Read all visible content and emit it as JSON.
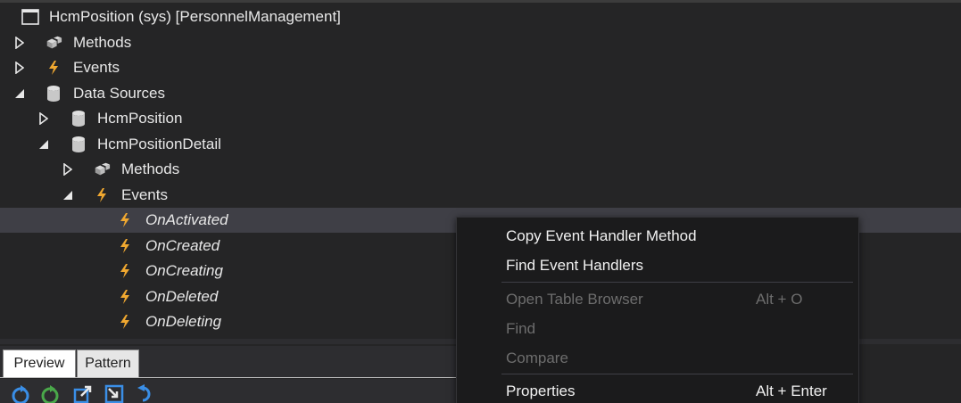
{
  "tree": {
    "root_label": "HcmPosition (sys) [PersonnelManagement]",
    "nodes": [
      {
        "label": "Methods",
        "icon": "methods-icon"
      },
      {
        "label": "Events",
        "icon": "event-icon"
      },
      {
        "label": "Data Sources",
        "icon": "datasource-icon"
      },
      {
        "label": "HcmPosition",
        "icon": "datasource-icon"
      },
      {
        "label": "HcmPositionDetail",
        "icon": "datasource-icon"
      },
      {
        "label": "Methods",
        "icon": "methods-icon"
      },
      {
        "label": "Events",
        "icon": "event-icon"
      },
      {
        "label": "OnActivated",
        "icon": "event-icon"
      },
      {
        "label": "OnCreated",
        "icon": "event-icon"
      },
      {
        "label": "OnCreating",
        "icon": "event-icon"
      },
      {
        "label": "OnDeleted",
        "icon": "event-icon"
      },
      {
        "label": "OnDeleting",
        "icon": "event-icon"
      }
    ]
  },
  "tabs": [
    {
      "label": "Preview"
    },
    {
      "label": "Pattern"
    }
  ],
  "context_menu": {
    "items": [
      {
        "label": "Copy Event Handler Method",
        "shortcut": ""
      },
      {
        "label": "Find Event Handlers",
        "shortcut": ""
      },
      {
        "label": "Open Table Browser",
        "shortcut": "Alt + O"
      },
      {
        "label": "Find",
        "shortcut": ""
      },
      {
        "label": "Compare",
        "shortcut": ""
      },
      {
        "label": "Properties",
        "shortcut": "Alt + Enter"
      }
    ]
  },
  "colors": {
    "background": "#252526",
    "selected_row": "#3f3f46",
    "event_bolt": "#f0a830",
    "menu_background": "#1b1b1c",
    "disabled_text": "#6d6d6d"
  }
}
